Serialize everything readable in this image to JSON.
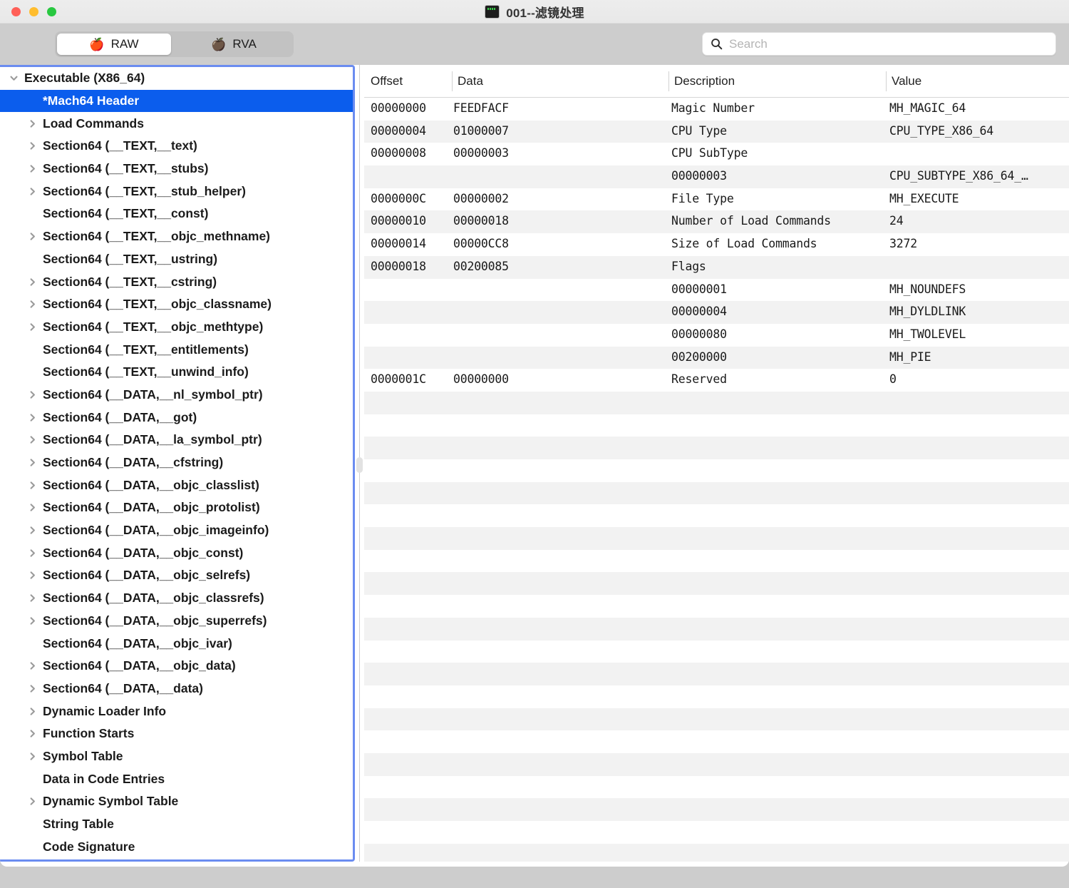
{
  "window": {
    "title": "001--滤镜处理",
    "title_icon": "terminal-icon",
    "traffic_lights": [
      "close-button",
      "minimize-button",
      "maximize-button"
    ]
  },
  "toolbar": {
    "tabs": [
      {
        "label": "RAW",
        "icon": "red-apple-icon",
        "selected": true
      },
      {
        "label": "RVA",
        "icon": "green-apple-icon",
        "selected": false
      }
    ],
    "search": {
      "placeholder": "Search",
      "value": "",
      "icon": "search-icon"
    }
  },
  "sidebar": {
    "items": [
      {
        "label": "Executable  (X86_64)",
        "level": 0,
        "chevron": "down",
        "selected": false
      },
      {
        "label": "*Mach64 Header",
        "level": 1,
        "chevron": "none",
        "selected": true
      },
      {
        "label": "Load Commands",
        "level": 1,
        "chevron": "right",
        "selected": false
      },
      {
        "label": "Section64 (__TEXT,__text)",
        "level": 1,
        "chevron": "right",
        "selected": false
      },
      {
        "label": "Section64 (__TEXT,__stubs)",
        "level": 1,
        "chevron": "right",
        "selected": false
      },
      {
        "label": "Section64 (__TEXT,__stub_helper)",
        "level": 1,
        "chevron": "right",
        "selected": false
      },
      {
        "label": "Section64 (__TEXT,__const)",
        "level": 1,
        "chevron": "none",
        "selected": false
      },
      {
        "label": "Section64 (__TEXT,__objc_methname)",
        "level": 1,
        "chevron": "right",
        "selected": false
      },
      {
        "label": "Section64 (__TEXT,__ustring)",
        "level": 1,
        "chevron": "none",
        "selected": false
      },
      {
        "label": "Section64 (__TEXT,__cstring)",
        "level": 1,
        "chevron": "right",
        "selected": false
      },
      {
        "label": "Section64 (__TEXT,__objc_classname)",
        "level": 1,
        "chevron": "right",
        "selected": false
      },
      {
        "label": "Section64 (__TEXT,__objc_methtype)",
        "level": 1,
        "chevron": "right",
        "selected": false
      },
      {
        "label": "Section64 (__TEXT,__entitlements)",
        "level": 1,
        "chevron": "none",
        "selected": false
      },
      {
        "label": "Section64 (__TEXT,__unwind_info)",
        "level": 1,
        "chevron": "none",
        "selected": false
      },
      {
        "label": "Section64 (__DATA,__nl_symbol_ptr)",
        "level": 1,
        "chevron": "right",
        "selected": false
      },
      {
        "label": "Section64 (__DATA,__got)",
        "level": 1,
        "chevron": "right",
        "selected": false
      },
      {
        "label": "Section64 (__DATA,__la_symbol_ptr)",
        "level": 1,
        "chevron": "right",
        "selected": false
      },
      {
        "label": "Section64 (__DATA,__cfstring)",
        "level": 1,
        "chevron": "right",
        "selected": false
      },
      {
        "label": "Section64 (__DATA,__objc_classlist)",
        "level": 1,
        "chevron": "right",
        "selected": false
      },
      {
        "label": "Section64 (__DATA,__objc_protolist)",
        "level": 1,
        "chevron": "right",
        "selected": false
      },
      {
        "label": "Section64 (__DATA,__objc_imageinfo)",
        "level": 1,
        "chevron": "right",
        "selected": false
      },
      {
        "label": "Section64 (__DATA,__objc_const)",
        "level": 1,
        "chevron": "right",
        "selected": false
      },
      {
        "label": "Section64 (__DATA,__objc_selrefs)",
        "level": 1,
        "chevron": "right",
        "selected": false
      },
      {
        "label": "Section64 (__DATA,__objc_classrefs)",
        "level": 1,
        "chevron": "right",
        "selected": false
      },
      {
        "label": "Section64 (__DATA,__objc_superrefs)",
        "level": 1,
        "chevron": "right",
        "selected": false
      },
      {
        "label": "Section64 (__DATA,__objc_ivar)",
        "level": 1,
        "chevron": "none",
        "selected": false
      },
      {
        "label": "Section64 (__DATA,__objc_data)",
        "level": 1,
        "chevron": "right",
        "selected": false
      },
      {
        "label": "Section64 (__DATA,__data)",
        "level": 1,
        "chevron": "right",
        "selected": false
      },
      {
        "label": "Dynamic Loader Info",
        "level": 1,
        "chevron": "right",
        "selected": false
      },
      {
        "label": "Function Starts",
        "level": 1,
        "chevron": "right",
        "selected": false
      },
      {
        "label": "Symbol Table",
        "level": 1,
        "chevron": "right",
        "selected": false
      },
      {
        "label": "Data in Code Entries",
        "level": 1,
        "chevron": "none",
        "selected": false
      },
      {
        "label": "Dynamic Symbol Table",
        "level": 1,
        "chevron": "right",
        "selected": false
      },
      {
        "label": "String Table",
        "level": 1,
        "chevron": "none",
        "selected": false
      },
      {
        "label": "Code Signature",
        "level": 1,
        "chevron": "none",
        "selected": false
      }
    ]
  },
  "table": {
    "columns": [
      "Offset",
      "Data",
      "Description",
      "Value"
    ],
    "rows": [
      {
        "offset": "00000000",
        "data": "FEEDFACF",
        "description": "Magic Number",
        "value": "MH_MAGIC_64"
      },
      {
        "offset": "00000004",
        "data": "01000007",
        "description": "CPU Type",
        "value": "CPU_TYPE_X86_64"
      },
      {
        "offset": "00000008",
        "data": "00000003",
        "description": "CPU SubType",
        "value": ""
      },
      {
        "offset": "",
        "data": "",
        "description": "00000003",
        "value": "CPU_SUBTYPE_X86_64_…"
      },
      {
        "offset": "0000000C",
        "data": "00000002",
        "description": "File Type",
        "value": "MH_EXECUTE"
      },
      {
        "offset": "00000010",
        "data": "00000018",
        "description": "Number of Load Commands",
        "value": "24"
      },
      {
        "offset": "00000014",
        "data": "00000CC8",
        "description": "Size of Load Commands",
        "value": "3272"
      },
      {
        "offset": "00000018",
        "data": "00200085",
        "description": "Flags",
        "value": ""
      },
      {
        "offset": "",
        "data": "",
        "description": "00000001",
        "value": "MH_NOUNDEFS"
      },
      {
        "offset": "",
        "data": "",
        "description": "00000004",
        "value": "MH_DYLDLINK"
      },
      {
        "offset": "",
        "data": "",
        "description": "00000080",
        "value": "MH_TWOLEVEL"
      },
      {
        "offset": "",
        "data": "",
        "description": "00200000",
        "value": "MH_PIE"
      },
      {
        "offset": "0000001C",
        "data": "00000000",
        "description": "Reserved",
        "value": "0"
      }
    ],
    "empty_row_count": 21
  },
  "colors": {
    "selection_blue": "#0b5ded",
    "focus_ring": "#6b8cf0",
    "row_alt": "#f2f2f2",
    "toolbar_bg": "#cdcdcd"
  }
}
